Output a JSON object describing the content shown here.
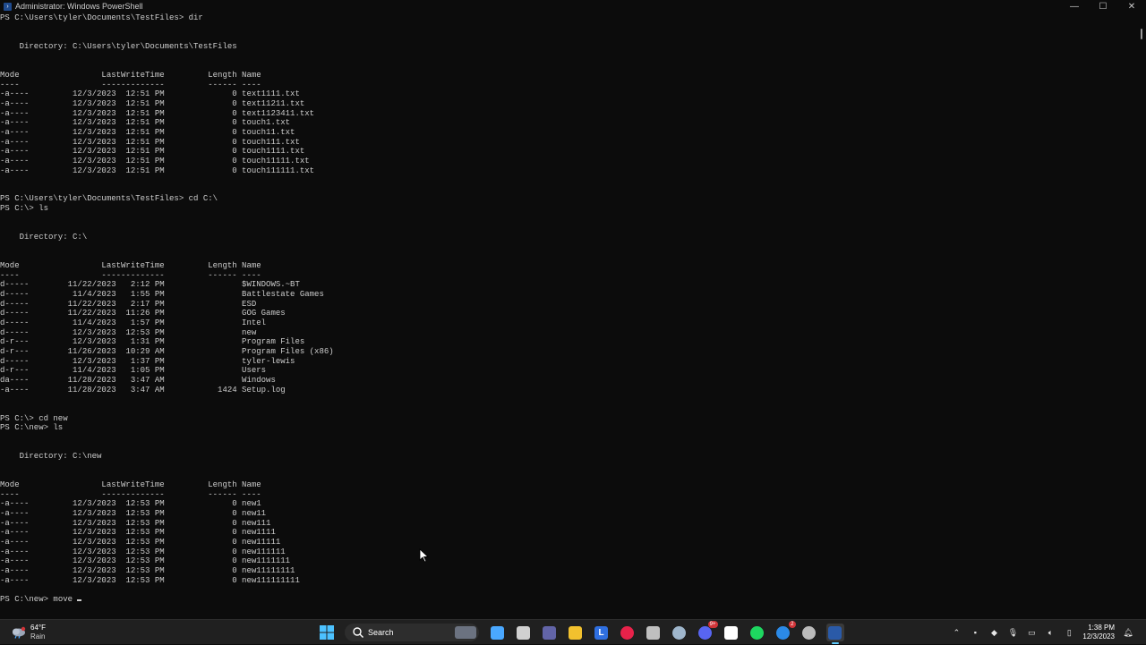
{
  "window": {
    "title": "Administrator: Windows PowerShell",
    "controls": {
      "minimize": "—",
      "maximize": "☐",
      "close": "✕"
    }
  },
  "console": {
    "lines": [
      "PS C:\\Users\\tyler\\Documents\\TestFiles> dir",
      "",
      "",
      "    Directory: C:\\Users\\tyler\\Documents\\TestFiles",
      "",
      "",
      "Mode                 LastWriteTime         Length Name",
      "----                 -------------         ------ ----",
      "-a----         12/3/2023  12:51 PM              0 text1111.txt",
      "-a----         12/3/2023  12:51 PM              0 text11211.txt",
      "-a----         12/3/2023  12:51 PM              0 text1123411.txt",
      "-a----         12/3/2023  12:51 PM              0 touch1.txt",
      "-a----         12/3/2023  12:51 PM              0 touch11.txt",
      "-a----         12/3/2023  12:51 PM              0 touch111.txt",
      "-a----         12/3/2023  12:51 PM              0 touch1111.txt",
      "-a----         12/3/2023  12:51 PM              0 touch11111.txt",
      "-a----         12/3/2023  12:51 PM              0 touch111111.txt",
      "",
      "",
      "PS C:\\Users\\tyler\\Documents\\TestFiles> cd C:\\",
      "PS C:\\> ls",
      "",
      "",
      "    Directory: C:\\",
      "",
      "",
      "Mode                 LastWriteTime         Length Name",
      "----                 -------------         ------ ----",
      "d-----        11/22/2023   2:12 PM                $WINDOWS.~BT",
      "d-----         11/4/2023   1:55 PM                Battlestate Games",
      "d-----        11/22/2023   2:17 PM                ESD",
      "d-----        11/22/2023  11:26 PM                GOG Games",
      "d-----         11/4/2023   1:57 PM                Intel",
      "d-----         12/3/2023  12:53 PM                new",
      "d-r---         12/3/2023   1:31 PM                Program Files",
      "d-r---        11/26/2023  10:29 AM                Program Files (x86)",
      "d-----         12/3/2023   1:37 PM                tyler-lewis",
      "d-r---         11/4/2023   1:05 PM                Users",
      "da----        11/28/2023   3:47 AM                Windows",
      "-a----        11/28/2023   3:47 AM           1424 Setup.log",
      "",
      "",
      "PS C:\\> cd new",
      "PS C:\\new> ls",
      "",
      "",
      "    Directory: C:\\new",
      "",
      "",
      "Mode                 LastWriteTime         Length Name",
      "----                 -------------         ------ ----",
      "-a----         12/3/2023  12:53 PM              0 new1",
      "-a----         12/3/2023  12:53 PM              0 new11",
      "-a----         12/3/2023  12:53 PM              0 new111",
      "-a----         12/3/2023  12:53 PM              0 new1111",
      "-a----         12/3/2023  12:53 PM              0 new11111",
      "-a----         12/3/2023  12:53 PM              0 new111111",
      "-a----         12/3/2023  12:53 PM              0 new1111111",
      "-a----         12/3/2023  12:53 PM              0 new11111111",
      "-a----         12/3/2023  12:53 PM              0 new111111111",
      ""
    ],
    "prompt": "PS C:\\new> ",
    "current_input": "move "
  },
  "taskbar": {
    "weather": {
      "temp": "64°F",
      "condition": "Rain"
    },
    "search_label": "Search",
    "apps": [
      {
        "name": "copilot-icon",
        "color": "#4aa8ff"
      },
      {
        "name": "task-view-icon",
        "color": "#d0d0d0"
      },
      {
        "name": "teams-chat-icon",
        "color": "#6264a7"
      },
      {
        "name": "file-explorer-icon",
        "color": "#f2c12e"
      },
      {
        "name": "l-app-icon",
        "color": "#2f6fe0",
        "glyph": "L"
      },
      {
        "name": "opera-gx-icon",
        "color": "#e8224a"
      },
      {
        "name": "game-controller-icon",
        "color": "#bfbfbf"
      },
      {
        "name": "steam-icon",
        "color": "#9fb6cc"
      },
      {
        "name": "discord-icon",
        "color": "#5865f2",
        "badge": "9+"
      },
      {
        "name": "steelseries-gear-icon",
        "color": "#ffffff"
      },
      {
        "name": "spotify-icon",
        "color": "#1ed760"
      },
      {
        "name": "edge-icon",
        "color": "#2b8ae8",
        "badge": "2"
      },
      {
        "name": "chrome-icon",
        "color": "#bbbbbb"
      },
      {
        "name": "powershell-icon",
        "color": "#2a5aa8"
      }
    ],
    "clock": {
      "time": "1:38 PM",
      "date": "12/3/2023"
    }
  },
  "colors": {
    "console_bg": "#0c0c0c",
    "console_fg": "#cccccc",
    "taskbar_bg": "#202020"
  }
}
